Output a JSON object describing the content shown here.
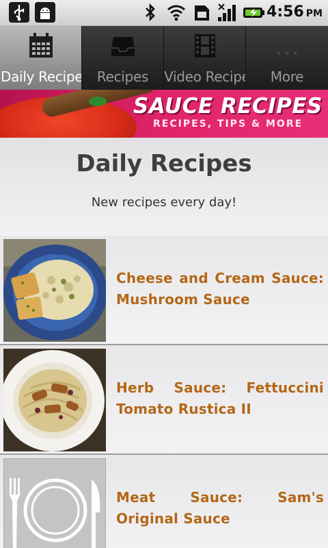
{
  "status_bar": {
    "icons": [
      "usb-icon",
      "android-debug-icon",
      "bluetooth-icon",
      "wifi-icon",
      "sim-icon",
      "signal-icon",
      "battery-charging-icon"
    ],
    "time": "4:56",
    "ampm": "PM"
  },
  "tabs": [
    {
      "label": "Daily Recipes",
      "icon": "calendar-icon",
      "active": true
    },
    {
      "label": "Recipes",
      "icon": "inbox-icon",
      "active": false
    },
    {
      "label": "Video Recipe",
      "icon": "film-icon",
      "active": false
    },
    {
      "label": "More",
      "icon": "more-dots-icon",
      "active": false
    }
  ],
  "banner": {
    "title": "SAUCE RECIPES",
    "subtitle": "RECIPES, TIPS & MORE"
  },
  "header": {
    "title": "Daily Recipes",
    "subtitle": "New recipes every day!"
  },
  "recipes": [
    {
      "title": "Cheese and Cream Sauce: Mushroom Sauce",
      "image": "pasta-with-garlic-bread-photo"
    },
    {
      "title": "Herb Sauce: Fettuccini Tomato Rustica II",
      "image": "fettuccini-with-chicken-photo"
    },
    {
      "title": "Meat Sauce: Sam's Original Sauce",
      "image": "plate-fork-knife-placeholder-icon"
    }
  ],
  "colors": {
    "recipe_title": "#b46716",
    "banner_bg": "#e0246a",
    "active_tab": "#9b9b9b"
  }
}
